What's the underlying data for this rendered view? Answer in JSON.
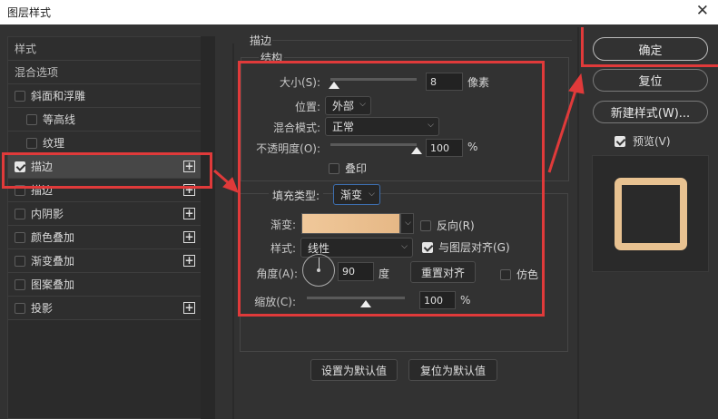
{
  "window": {
    "title": "图层样式",
    "close_icon": "close-icon"
  },
  "sidebar": {
    "items": [
      {
        "label": "样式",
        "checkbox": false,
        "plain": true
      },
      {
        "label": "混合选项",
        "checkbox": false,
        "plain": true
      },
      {
        "label": "斜面和浮雕",
        "checked": false
      },
      {
        "label": "等高线",
        "checked": false,
        "indent": true
      },
      {
        "label": "纹理",
        "checked": false,
        "indent": true
      },
      {
        "label": "描边",
        "checked": true,
        "plus": true,
        "selected": true
      },
      {
        "label": "描边",
        "checked": false,
        "plus": true
      },
      {
        "label": "内阴影",
        "checked": false,
        "plus": true
      },
      {
        "label": "颜色叠加",
        "checked": false,
        "plus": true
      },
      {
        "label": "渐变叠加",
        "checked": false,
        "plus": true
      },
      {
        "label": "图案叠加",
        "checked": false
      },
      {
        "label": "投影",
        "checked": false,
        "plus": true
      }
    ]
  },
  "stroke": {
    "group_title": "描边",
    "structure_title": "结构",
    "size_label": "大小(S):",
    "size_value": "8",
    "size_unit": "像素",
    "size_fraction": 0.04,
    "position_label": "位置:",
    "position_value": "外部",
    "blend_label": "混合模式:",
    "blend_value": "正常",
    "opacity_label": "不透明度(O):",
    "opacity_value": "100",
    "opacity_unit": "%",
    "opacity_fraction": 1.0,
    "overprint_label": "叠印",
    "overprint_checked": false,
    "fill_type_label": "填充类型:",
    "fill_type_value": "渐变",
    "gradient_label": "渐变:",
    "gradient_colors": [
      "#f0c89a",
      "#e6b886"
    ],
    "reverse_label": "反向(R)",
    "reverse_checked": false,
    "style_label": "样式:",
    "style_value": "线性",
    "align_label": "与图层对齐(G)",
    "align_checked": true,
    "angle_label": "角度(A):",
    "angle_value": "90",
    "angle_unit": "度",
    "reset_align_label": "重置对齐",
    "dither_label": "仿色",
    "dither_checked": false,
    "scale_label": "缩放(C):",
    "scale_value": "100",
    "scale_unit": "%",
    "scale_fraction": 0.6,
    "set_default_label": "设置为默认值",
    "reset_default_label": "复位为默认值"
  },
  "actions": {
    "ok_label": "确定",
    "reset_label": "复位",
    "new_style_label": "新建样式(W)...",
    "preview_label": "预览(V)",
    "preview_checked": true
  },
  "colors": {
    "highlight": "#e03a3a",
    "stroke_preview": "#e8c291"
  }
}
